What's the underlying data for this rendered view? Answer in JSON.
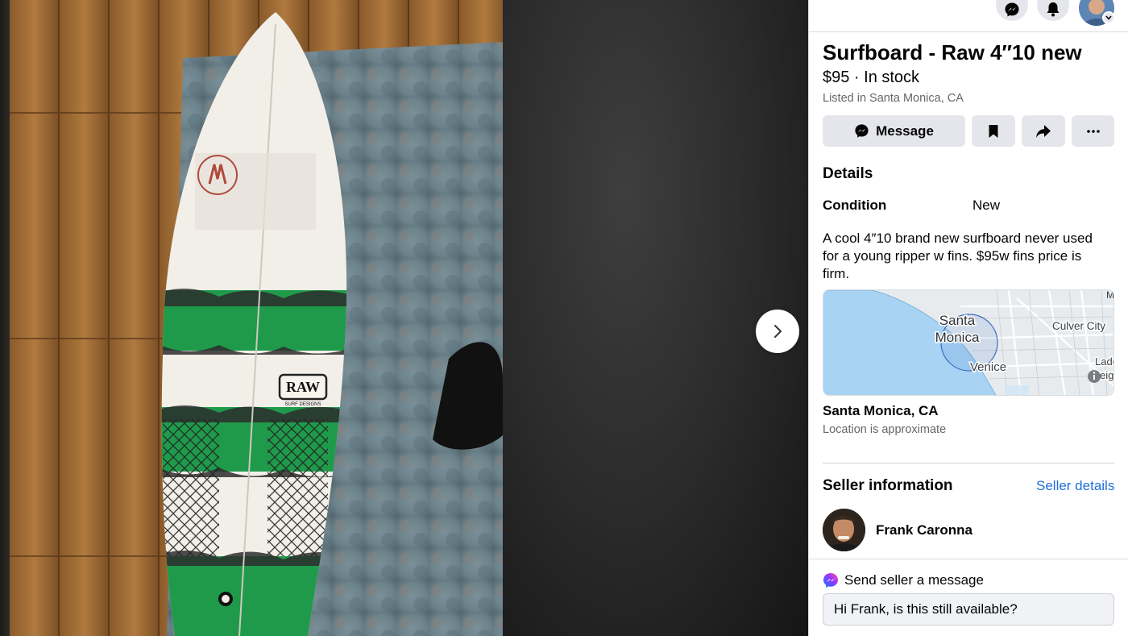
{
  "listing": {
    "title": "Surfboard - Raw 4″10 new",
    "price_line": "$95 · In stock",
    "listed_in": "Listed in Santa Monica, CA"
  },
  "actions": {
    "message_label": "Message"
  },
  "details": {
    "heading": "Details",
    "condition_label": "Condition",
    "condition_value": "New",
    "description": "A cool 4″10 brand new surfboard never used for a young ripper w fins. $95w fins price is firm."
  },
  "map": {
    "labels": {
      "santa": "Santa",
      "monica": "Monica",
      "culver_city": "Culver City",
      "venice": "Venice",
      "lade": "Lade",
      "eigh": "eigh",
      "m": "M"
    }
  },
  "location": {
    "name": "Santa Monica, CA",
    "note": "Location is approximate"
  },
  "seller": {
    "heading": "Seller information",
    "details_link": "Seller details",
    "name": "Frank Caronna"
  },
  "send": {
    "label": "Send seller a message",
    "input_value": "Hi Frank, is this still available?"
  },
  "photo_text": {
    "logo_text": "RAW",
    "logo_sub": "SURF DESIGNS"
  },
  "icons": {
    "messenger": "messenger-icon",
    "notifications": "bell-icon",
    "save": "bookmark-icon",
    "share": "share-icon",
    "more": "more-icon",
    "next": "chevron-right-icon"
  },
  "colors": {
    "link": "#216fdb",
    "button_bg": "#e4e6eb",
    "board_green": "#1f9a4b"
  }
}
